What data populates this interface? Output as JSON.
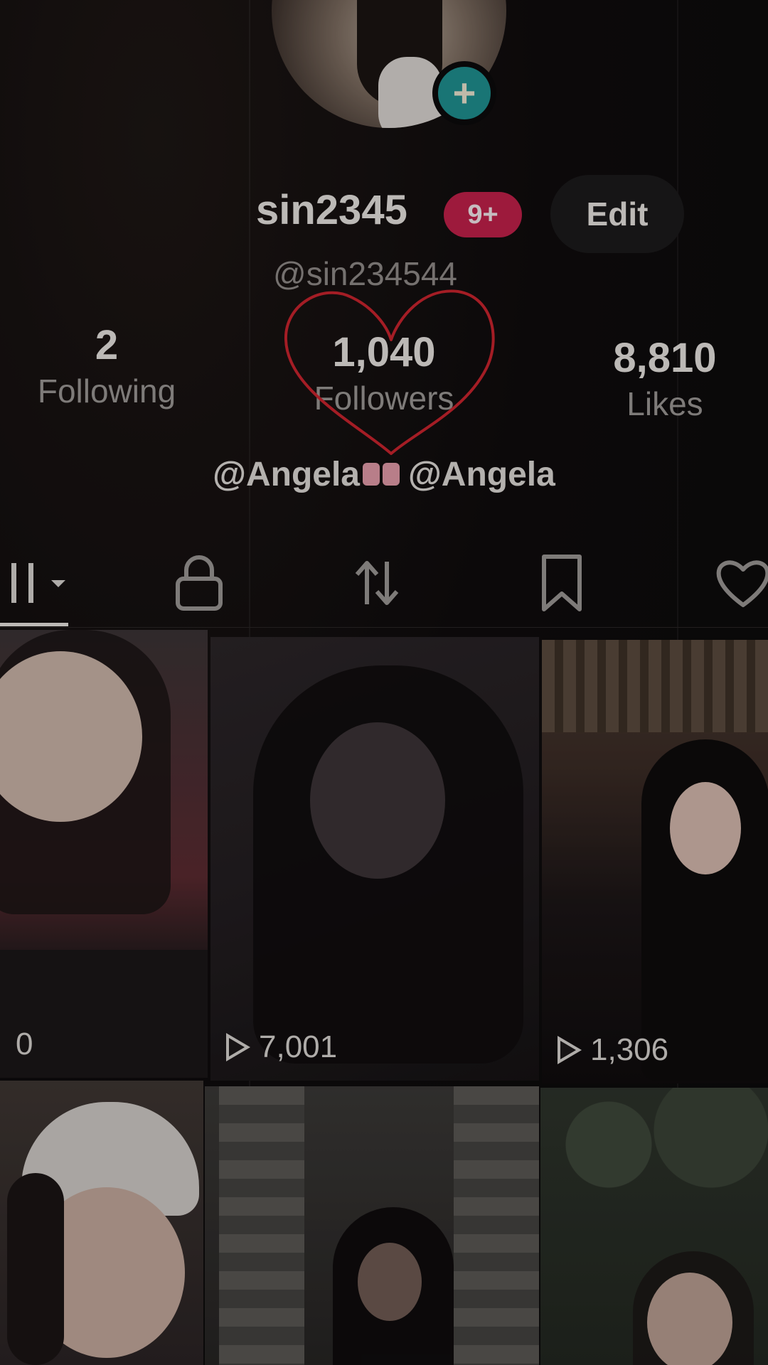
{
  "profile": {
    "display_name": "sin2345",
    "notification_badge": "9+",
    "edit_label": "Edit",
    "handle": "@sin234544",
    "add_icon": "plus-icon"
  },
  "stats": {
    "following": {
      "count": "2",
      "label": "Following"
    },
    "followers": {
      "count": "1,040",
      "label": "Followers"
    },
    "likes": {
      "count": "8,810",
      "label": "Likes"
    }
  },
  "bio": {
    "mention_1": "@Angela",
    "mention_2": "@Angela",
    "emoji": "ribbon-bow-emoji"
  },
  "tabs": [
    {
      "name": "videos",
      "icon": "grid-icon",
      "selected": true
    },
    {
      "name": "private",
      "icon": "lock-icon"
    },
    {
      "name": "reposts",
      "icon": "repost-icon"
    },
    {
      "name": "favorites",
      "icon": "bookmark-icon"
    },
    {
      "name": "liked",
      "icon": "heart-icon"
    }
  ],
  "videos": [
    {
      "views": "0"
    },
    {
      "views": "7,001"
    },
    {
      "views": "1,306"
    },
    {
      "views": ""
    },
    {
      "views": ""
    },
    {
      "views": ""
    }
  ],
  "colors": {
    "badge": "#c0204a",
    "add_button": "#1f8f8f",
    "heart_doodle": "#c8242e"
  }
}
